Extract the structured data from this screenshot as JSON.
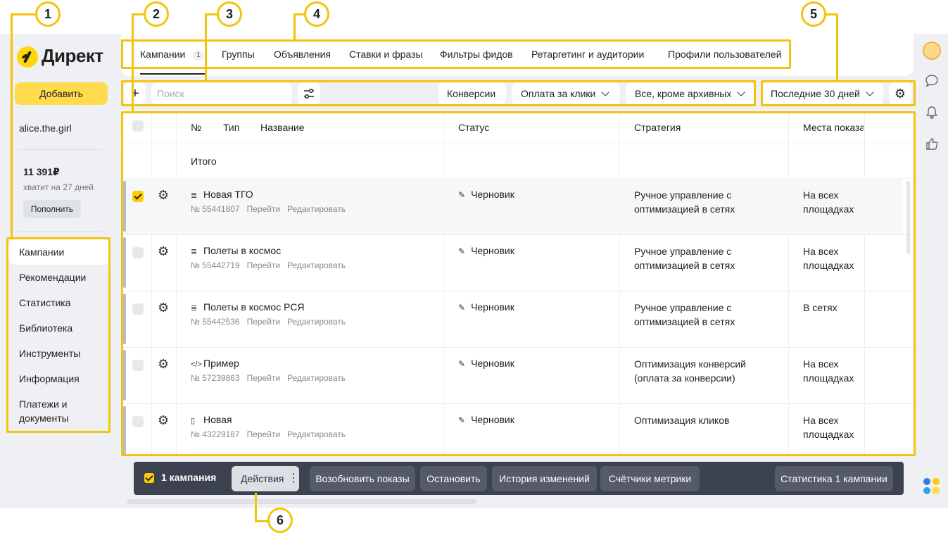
{
  "brand": {
    "name": "Директ"
  },
  "sidebar": {
    "add_label": "Добавить",
    "username": "alice.the.girl",
    "balance": "11 391₽",
    "balance_note": "хватит на 27 дней",
    "topup_label": "Пополнить",
    "items": [
      {
        "label": "Кампании"
      },
      {
        "label": "Рекомендации"
      },
      {
        "label": "Статистика"
      },
      {
        "label": "Библиотека"
      },
      {
        "label": "Инструменты"
      },
      {
        "label": "Информация"
      },
      {
        "label": "Платежи и документы"
      }
    ]
  },
  "tabs": [
    {
      "label": "Кампании",
      "badge": "1"
    },
    {
      "label": "Группы"
    },
    {
      "label": "Объявления"
    },
    {
      "label": "Ставки и фразы"
    },
    {
      "label": "Фильтры фидов"
    },
    {
      "label": "Ретаргетинг и аудитории"
    },
    {
      "label": "Профили пользователей"
    }
  ],
  "toolbar": {
    "add_symbol": "+",
    "search_placeholder": "Поиск",
    "conversions_label": "Конверсии",
    "payment_label": "Оплата за клики",
    "filter_label": "Все, кроме архивных",
    "period_label": "Последние 30 дней"
  },
  "table": {
    "headers": {
      "number": "№",
      "type": "Тип",
      "name": "Название",
      "status": "Статус",
      "strategy": "Стратегия",
      "placement": "Места показа"
    },
    "total_label": "Итого",
    "link_go": "Перейти",
    "link_edit": "Редактировать",
    "rows": [
      {
        "name": "Новая ТГО",
        "icon": "text-ad-icon",
        "number": "№ 55441807",
        "status": "Черновик",
        "strategy": "Ручное управление с оптимизацией в сетях",
        "placement": "На всех площадках",
        "checked": true
      },
      {
        "name": "Полеты в космос",
        "icon": "text-ad-icon",
        "number": "№ 55442719",
        "status": "Черновик",
        "strategy": "Ручное управление с оптимизацией в сетях",
        "placement": "На всех площадках",
        "checked": false
      },
      {
        "name": "Полеты в космос РСЯ",
        "icon": "text-ad-icon",
        "number": "№ 55442536",
        "status": "Черновик",
        "strategy": "Ручное управление с оптимизацией в сетях",
        "placement": "В сетях",
        "checked": false
      },
      {
        "name": "Пример",
        "icon": "code-icon",
        "number": "№ 57239863",
        "status": "Черновик",
        "strategy": "Оптимизация конверсий (оплата за конверсии)",
        "placement": "На всех площадках",
        "checked": false
      },
      {
        "name": "Новая",
        "icon": "mobile-icon",
        "number": "№ 43229187",
        "status": "Черновик",
        "strategy": "Оптимизация кликов",
        "placement": "На всех площадках",
        "checked": false
      }
    ]
  },
  "action_bar": {
    "selected": "1 кампания",
    "actions_label": "Действия",
    "resume_label": "Возобновить показы",
    "stop_label": "Остановить",
    "history_label": "История изменений",
    "counters_label": "Счётчики метрики",
    "stats_label": "Статистика 1 кампании"
  },
  "annotations": [
    "1",
    "2",
    "3",
    "4",
    "5",
    "6"
  ],
  "colors": {
    "accent": "#ffdb4d",
    "annotation": "#f2c40c",
    "sidebar_bg": "#eef0f4",
    "action_bar_bg": "#3c424f"
  }
}
